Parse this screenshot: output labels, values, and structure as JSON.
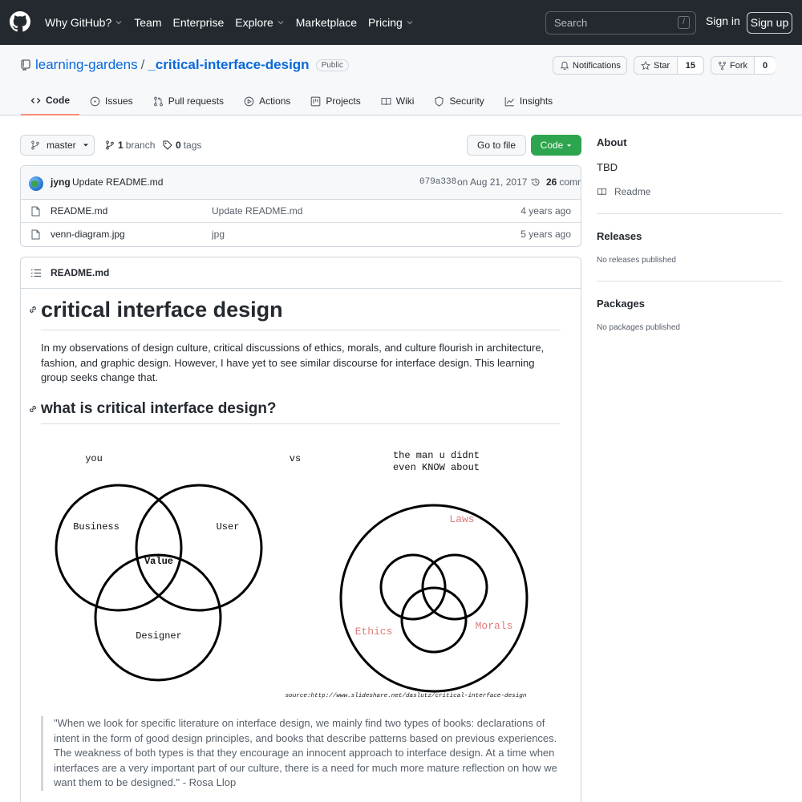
{
  "header": {
    "nav": [
      "Why GitHub?",
      "Team",
      "Enterprise",
      "Explore",
      "Marketplace",
      "Pricing"
    ],
    "search_placeholder": "Search",
    "search_shortcut": "/",
    "sign_in": "Sign in",
    "sign_up": "Sign up"
  },
  "repo": {
    "owner": "learning-gardens",
    "separator": "/",
    "name": "_critical-interface-design",
    "visibility": "Public",
    "notifications_label": "Notifications",
    "star_label": "Star",
    "star_count": "15",
    "fork_label": "Fork",
    "fork_count": "0",
    "tabs": [
      "Code",
      "Issues",
      "Pull requests",
      "Actions",
      "Projects",
      "Wiki",
      "Security",
      "Insights"
    ]
  },
  "code": {
    "branch": "master",
    "branch_count": "1",
    "branch_label": "branch",
    "tag_count": "0",
    "tag_label": "tags",
    "goto_file": "Go to file",
    "code_button": "Code",
    "commit": {
      "author": "jyng",
      "message": "Update README.md",
      "sha": "079a338",
      "date": "on Aug 21, 2017",
      "count": "26",
      "count_label": "commits"
    },
    "files": [
      {
        "name": "README.md",
        "message": "Update README.md",
        "age": "4 years ago"
      },
      {
        "name": "venn-diagram.jpg",
        "message": "jpg",
        "age": "5 years ago"
      }
    ]
  },
  "readme": {
    "file_title": "README.md",
    "h1": "critical interface design",
    "intro": "In my observations of design culture, critical discussions of ethics, morals, and culture flourish in architecture, fashion, and graphic design. However, I have yet to see similar discourse for interface design. This learning group seeks change that.",
    "h2": "what is critical interface design?",
    "diagram": {
      "left_title": "you",
      "vs": "vs",
      "right_title_1": "the man u didnt",
      "right_title_2": "even KNOW about",
      "business": "Business",
      "user": "User",
      "value": "Value",
      "designer": "Designer",
      "laws": "Laws",
      "ethics": "Ethics",
      "morals": "Morals",
      "source": "source:http://www.slideshare.net/daslutz/critical-interface-design",
      "accent_color": "#e07b7b"
    },
    "quote": "\"When we look for specific literature on interface design, we mainly find two types of books: declarations of intent in the form of good design principles, and books that describe patterns based on previous experiences. The weakness of both types is that they encourage an innocent approach to interface design. At a time when interfaces are a very important part of our culture, there is a need for much more mature reflection on how we want them to be designed.\" - Rosa Llop"
  },
  "sidebar": {
    "about_title": "About",
    "about_text": "TBD",
    "readme_link": "Readme",
    "releases_title": "Releases",
    "releases_text": "No releases published",
    "packages_title": "Packages",
    "packages_text": "No packages published"
  }
}
